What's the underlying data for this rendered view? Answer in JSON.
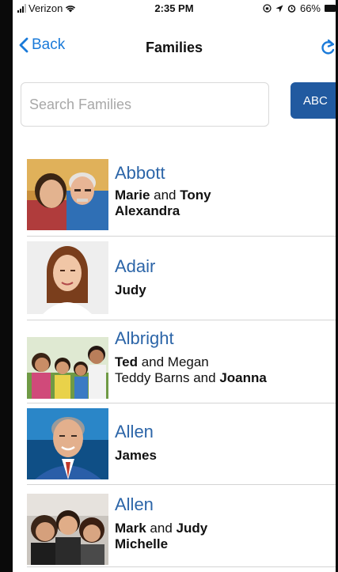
{
  "status_bar": {
    "carrier": "Verizon",
    "time": "2:35 PM",
    "battery": "66%"
  },
  "nav": {
    "back_label": "Back",
    "title": "Families"
  },
  "search": {
    "placeholder": "Search Families"
  },
  "sort_button": {
    "label": "ABC"
  },
  "families": [
    {
      "surname": "Abbott",
      "line1": [
        {
          "t": "Marie",
          "b": true
        },
        {
          "t": " and ",
          "b": false
        },
        {
          "t": "Tony",
          "b": true
        }
      ],
      "line2": [
        {
          "t": "Alexandra",
          "b": true
        }
      ],
      "photo_icon": "family-photo-couple-icon"
    },
    {
      "surname": "Adair",
      "line1": [
        {
          "t": "Judy",
          "b": true
        }
      ],
      "line2": [],
      "photo_icon": "family-photo-woman-icon"
    },
    {
      "surname": "Albright",
      "line1": [
        {
          "t": "Ted",
          "b": true
        },
        {
          "t": " and Megan",
          "b": false
        }
      ],
      "line2": [
        {
          "t": "Teddy Barns and ",
          "b": false
        },
        {
          "t": "Joanna",
          "b": true
        }
      ],
      "photo_icon": "family-photo-group-icon"
    },
    {
      "surname": "Allen",
      "line1": [
        {
          "t": "James",
          "b": true
        }
      ],
      "line2": [],
      "photo_icon": "family-photo-man-icon"
    },
    {
      "surname": "Allen",
      "line1": [
        {
          "t": "Mark",
          "b": true
        },
        {
          "t": " and ",
          "b": false
        },
        {
          "t": "Judy",
          "b": true
        }
      ],
      "line2": [
        {
          "t": "Michelle",
          "b": true
        }
      ],
      "photo_icon": "family-photo-trio-icon"
    }
  ],
  "colors": {
    "accent": "#1a7ad9",
    "surname": "#2c65a8",
    "sort_button": "#215aa0"
  }
}
